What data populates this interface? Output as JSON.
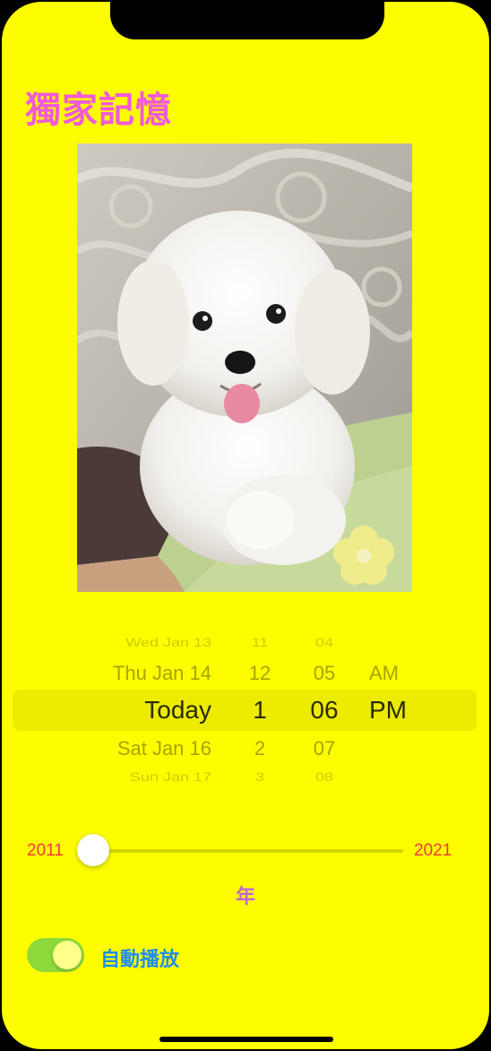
{
  "title": "獨家記憶",
  "photo": {
    "description_icon": "dog-photo"
  },
  "date_picker": {
    "rows": [
      {
        "date": "Wed Jan 13",
        "hour": "11",
        "minute": "04",
        "ampm": ""
      },
      {
        "date": "Thu Jan 14",
        "hour": "12",
        "minute": "05",
        "ampm": "AM"
      },
      {
        "date": "Today",
        "hour": "1",
        "minute": "06",
        "ampm": "PM"
      },
      {
        "date": "Sat Jan 16",
        "hour": "2",
        "minute": "07",
        "ampm": ""
      },
      {
        "date": "Sun Jan 17",
        "hour": "3",
        "minute": "08",
        "ampm": ""
      }
    ]
  },
  "slider": {
    "min_label": "2011",
    "max_label": "2021",
    "value_fraction": 0.0,
    "caption": "年",
    "accent": "#3a7bf0"
  },
  "toggle": {
    "label": "自動播放",
    "on": true,
    "on_color": "#8ed93a"
  },
  "colors": {
    "background": "#fefd00",
    "title": "#f05ad8",
    "slider_labels": "#ef3a3a",
    "toggle_label": "#1f8ee8"
  }
}
